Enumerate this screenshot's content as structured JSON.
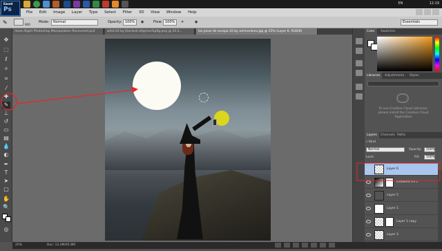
{
  "taskbar": {
    "app_badge": "Ps",
    "app_badge_sub": "Eased",
    "lang": "EN",
    "time": "12:19"
  },
  "menu": {
    "items": [
      "File",
      "Edit",
      "Image",
      "Layer",
      "Type",
      "Select",
      "Filter",
      "3D",
      "View",
      "Window",
      "Help"
    ]
  },
  "options": {
    "brush_size": "600",
    "mode_label": "Mode:",
    "mode_value": "Normal",
    "opacity_label": "Opacity:",
    "opacity_value": "100%",
    "flow_label": "Flow:",
    "flow_value": "100%",
    "workspace": "Essentials"
  },
  "doc_tabs": [
    {
      "label": "moon Night Photoshop Manipulation Recovered.psd",
      "active": false
    },
    {
      "label": "witch16 by Eloclock-d4gmecl5p9g.png @ 33.3...",
      "active": false
    },
    {
      "label": "los picos de europa 10 by adrmarkeev.jpg @ 25% (Layer 6, RGB/8)",
      "active": true
    }
  ],
  "panels": {
    "color_tabs": [
      "Color",
      "Swatches"
    ],
    "lib_tabs": [
      "Libraries",
      "Adjustments",
      "Styles"
    ],
    "lib_message_1": "To use Creative Cloud Libraries,",
    "lib_message_2": "please install the Creative Cloud",
    "lib_message_3": "Application",
    "layers_tabs": [
      "Layers",
      "Channels",
      "Paths"
    ],
    "kind_label": "Kind",
    "blend_mode": "Normal",
    "opacity_label": "Opacity:",
    "opacity_value": "100%",
    "lock_label": "Lock:",
    "fill_label": "Fill:",
    "fill_value": "100%"
  },
  "layers": [
    {
      "name": "Layer 6",
      "selected": true
    },
    {
      "name": "Gradient Fill 1",
      "selected": false
    },
    {
      "name": "Layer 5",
      "selected": false
    },
    {
      "name": "Layer 1",
      "selected": false
    },
    {
      "name": "Layer 1 copy",
      "selected": false
    },
    {
      "name": "Layer 3",
      "selected": false
    }
  ],
  "status": {
    "zoom": "25%",
    "doc": "Doc: 13.2M/45.8M"
  },
  "colors": {
    "annotation": "#e8262a",
    "selected_layer": "#a9c6ef",
    "moon": "#fbfbf4",
    "lantern_glow": "#d9d61d"
  }
}
